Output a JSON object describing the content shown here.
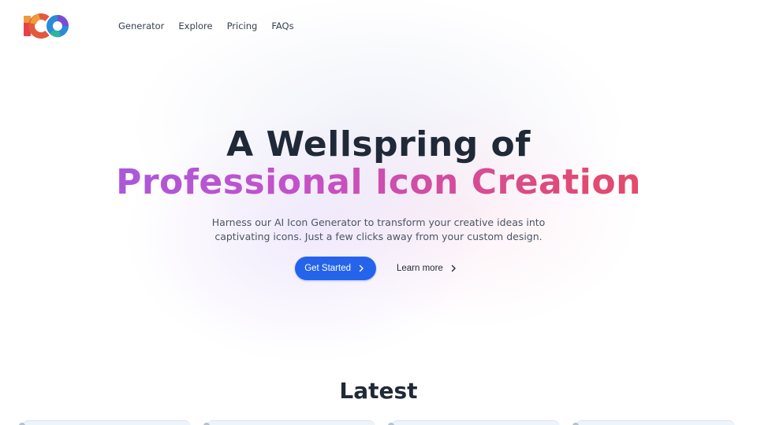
{
  "brand": {
    "logo_text": "ICO",
    "logo_colors": [
      "#e83f4b",
      "#f29a38",
      "#2b8bd8",
      "#7c4bd4"
    ]
  },
  "nav": {
    "items": [
      {
        "label": "Generator"
      },
      {
        "label": "Explore"
      },
      {
        "label": "Pricing"
      },
      {
        "label": "FAQs"
      }
    ]
  },
  "hero": {
    "title_line1": "A Wellspring of",
    "title_line2": "Professional Icon Creation",
    "subtitle": "Harness our AI Icon Generator to transform your creative ideas into captivating icons. Just a few clicks away from your custom design.",
    "primary_cta": "Get Started",
    "secondary_cta": "Learn more",
    "gradient_colors": [
      "#9b5de5",
      "#e94b57"
    ],
    "primary_color": "#2563eb"
  },
  "latest": {
    "title": "Latest"
  },
  "icons": {
    "chevron": "chevron-right-icon"
  }
}
